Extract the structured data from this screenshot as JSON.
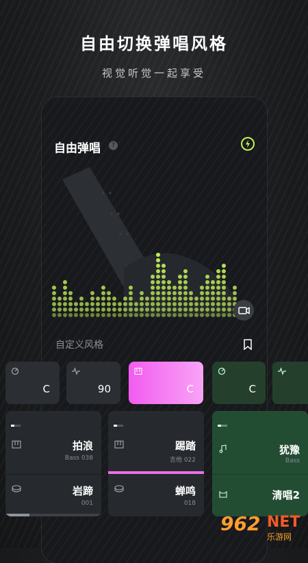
{
  "promo": {
    "headline": "自由切换弹唱风格",
    "subline": "视觉听觉一起享受"
  },
  "card": {
    "title": "自由弹唱",
    "help_icon_text": "?",
    "style_label": "自定义风格"
  },
  "chips": [
    {
      "icon": "tuner-icon",
      "value": "C"
    },
    {
      "icon": "waveform-icon",
      "value": "90"
    },
    {
      "icon": "keyboard-icon",
      "value": "C"
    },
    {
      "icon": "tuner-icon",
      "value": "C"
    },
    {
      "icon": "waveform-icon",
      "value": ""
    }
  ],
  "tiles": [
    {
      "top": {
        "name": "拍浪",
        "meta": "Bass  038"
      },
      "bottom": {
        "name": "岩蹄",
        "meta": "001"
      }
    },
    {
      "top": {
        "name": "踢踏",
        "meta": "吉他  022"
      },
      "bottom": {
        "name": "蝉鸣",
        "meta": "018"
      }
    },
    {
      "top": {
        "name": "犹豫",
        "meta": "Bass"
      },
      "bottom": {
        "name": "清唱2",
        "meta": ""
      }
    }
  ],
  "colors": {
    "accent_green": "#c6f25a",
    "accent_pink": "#f25cf0",
    "tile_green": "#234d33"
  },
  "watermark": {
    "num": "962",
    "net": "NET",
    "cn": "乐游网"
  }
}
